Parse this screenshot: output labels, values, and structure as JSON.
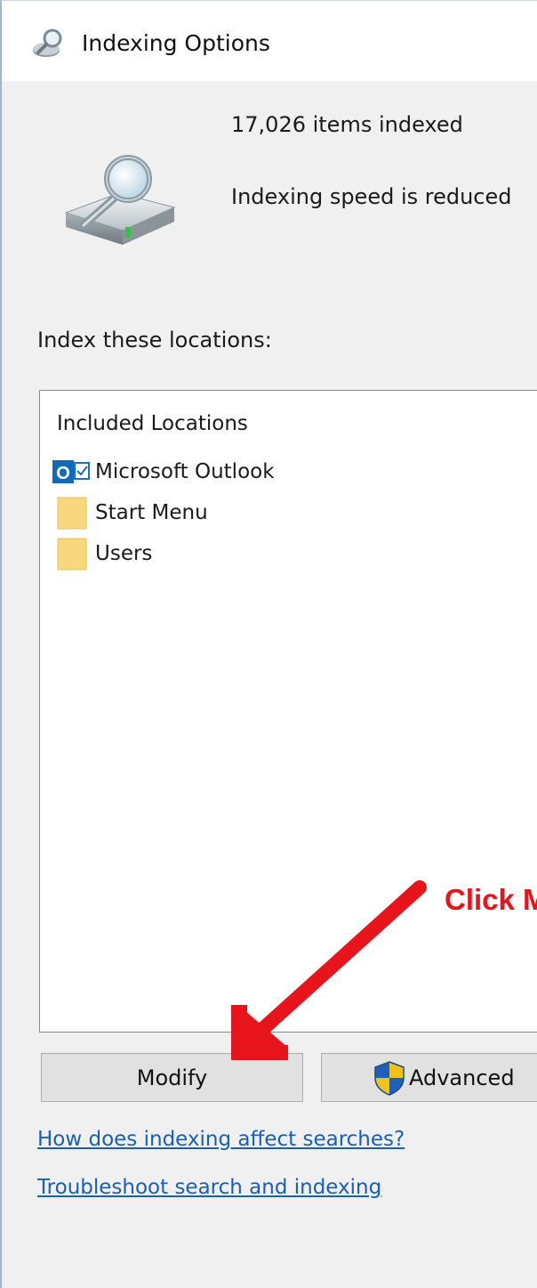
{
  "window": {
    "title": "Indexing Options",
    "title_icon": "indexing-magnifier-icon"
  },
  "status": {
    "items_indexed": "17,026 items indexed",
    "speed_message": "Indexing speed is reduced",
    "hero_icon": "drive-magnifier-icon"
  },
  "locations": {
    "section_label": "Index these locations:",
    "column_header": "Included Locations",
    "items": [
      {
        "label": "Microsoft Outlook",
        "icon": "outlook-icon"
      },
      {
        "label": "Start Menu",
        "icon": "folder-icon"
      },
      {
        "label": "Users",
        "icon": "folder-icon"
      }
    ]
  },
  "buttons": {
    "modify_label": "Modify",
    "advanced_label": "Advanced",
    "advanced_icon": "uac-shield-icon"
  },
  "links": {
    "how_indexing": "How does indexing affect searches?",
    "troubleshoot": "Troubleshoot search and indexing"
  },
  "annotation": {
    "text": "Click M",
    "color": "#e8141b",
    "icon": "red-arrow-icon"
  },
  "colors": {
    "link": "#1a5fb4",
    "window_bg": "#f0f0f0",
    "button_bg": "#e1e1e1"
  }
}
